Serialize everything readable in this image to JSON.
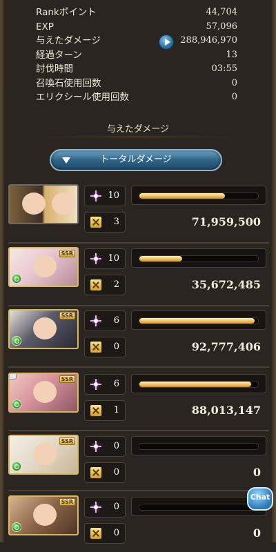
{
  "stats": [
    {
      "label": "Rankポイント",
      "value": "44,704"
    },
    {
      "label": "EXP",
      "value": "57,096"
    },
    {
      "label": "与えたダメージ",
      "value": "288,946,970"
    },
    {
      "label": "経過ターン",
      "value": "13"
    },
    {
      "label": "討伐時間",
      "value": "03:55"
    },
    {
      "label": "召喚石使用回数",
      "value": "0"
    },
    {
      "label": "エリクシール使用回数",
      "value": "0"
    }
  ],
  "section_title": "与えたダメージ",
  "tab_label": "トータルダメージ",
  "chat_label": "Chat",
  "colors": {
    "gold_bar": "#f0bd5b",
    "tab_blue": "#2f6486",
    "wind_element": "#2c8a2f"
  },
  "players": [
    {
      "portrait": "dual-character-portrait",
      "special": "10",
      "turns": "3",
      "damage": "71,959,500",
      "gauge": 0.72
    },
    {
      "portrait": "ssr-pink-hair-portrait",
      "special": "10",
      "turns": "2",
      "damage": "35,672,485",
      "gauge": 0.36,
      "ssr": "SSR"
    },
    {
      "portrait": "ssr-dark-hair-portrait",
      "special": "6",
      "turns": "0",
      "damage": "92,777,406",
      "gauge": 0.97,
      "ssr": "SSR"
    },
    {
      "portrait": "ssr-pink-hair-portrait-2",
      "special": "6",
      "turns": "1",
      "damage": "88,013,147",
      "gauge": 0.94,
      "ssr": "SSR"
    },
    {
      "portrait": "ssr-elder-portrait",
      "special": "0",
      "turns": "0",
      "damage": "0",
      "gauge": 0,
      "ssr": "SSR"
    },
    {
      "portrait": "ssr-brown-hair-portrait",
      "special": "0",
      "turns": "0",
      "damage": "0",
      "gauge": 0,
      "ssr": "SSR"
    }
  ]
}
